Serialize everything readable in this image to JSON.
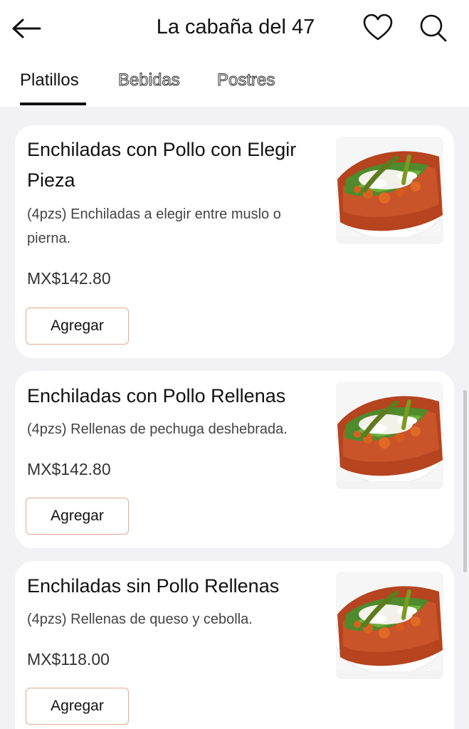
{
  "header": {
    "title": "La cabaña del 47",
    "back_icon": "arrow-left-icon",
    "favorite_icon": "heart-icon",
    "search_icon": "search-icon"
  },
  "tabs": [
    {
      "label": "Platillos",
      "active": true
    },
    {
      "label": "Bebidas",
      "active": false
    },
    {
      "label": "Postres",
      "active": false
    }
  ],
  "menu_items": [
    {
      "name": "Enchiladas con Pollo con Elegir Pieza",
      "description": "(4pzs) Enchiladas a elegir entre muslo o pierna.",
      "price": "MX$142.80",
      "button": "Agregar"
    },
    {
      "name": "Enchiladas con Pollo Rellenas",
      "description": "(4pzs) Rellenas de pechuga deshebrada.",
      "price": "MX$142.80",
      "button": "Agregar"
    },
    {
      "name": "Enchiladas sin Pollo Rellenas",
      "description": "(4pzs) Rellenas de queso y cebolla.",
      "price": "MX$118.00",
      "button": "Agregar"
    }
  ],
  "colors": {
    "background": "#f2f2f5",
    "card": "#ffffff",
    "button_border": "#e6a98c",
    "text": "#111111"
  }
}
